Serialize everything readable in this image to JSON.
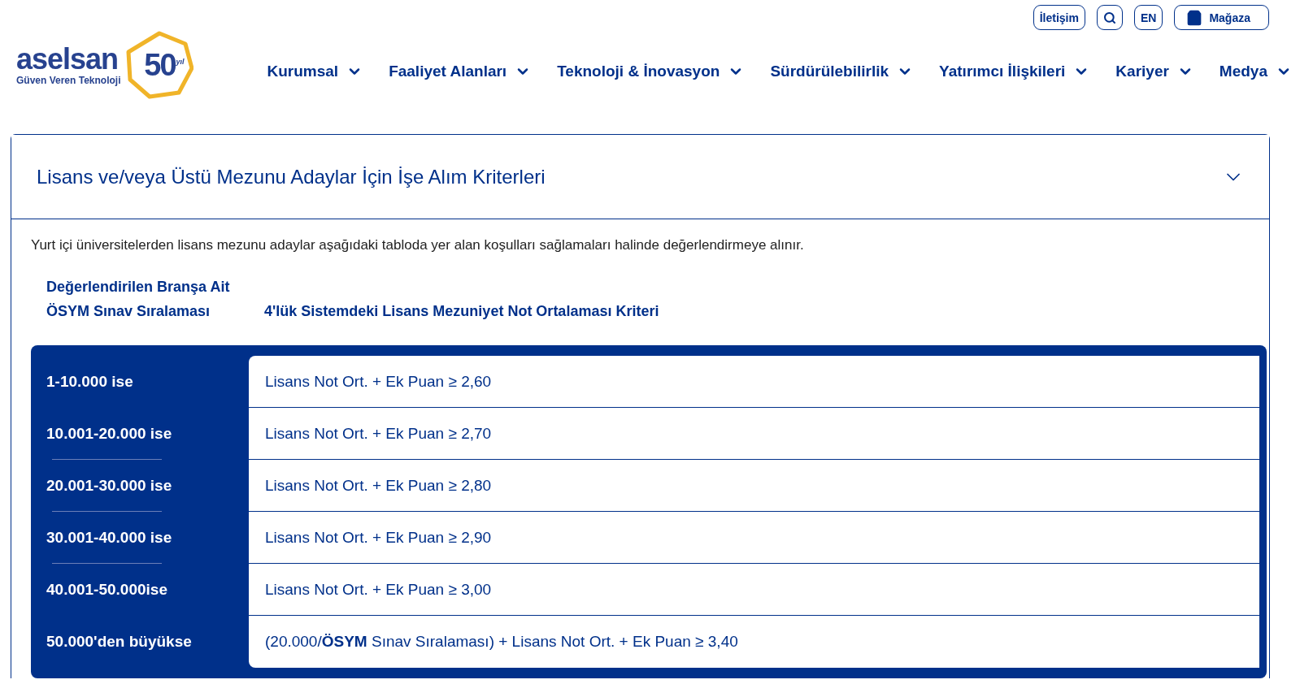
{
  "logo": {
    "wordmark": "aselsan",
    "tagline": "Güven Veren Teknoloji",
    "badge_number": "50",
    "badge_suffix": "yıl"
  },
  "top_links": [
    {
      "kind": "text",
      "label": "İletişim"
    },
    {
      "kind": "search"
    },
    {
      "kind": "text",
      "label": "EN"
    },
    {
      "kind": "shop",
      "label": "Mağaza"
    }
  ],
  "nav": [
    "Kurumsal",
    "Faaliyet Alanları",
    "Teknoloji & İnovasyon",
    "Sürdürülebilirlik",
    "Yatırımcı İlişkileri",
    "Kariyer",
    "Medya"
  ],
  "accordion": {
    "title": "Lisans ve/veya Üstü Mezunu Adaylar İçin İşe Alım Kriterleri",
    "expanded": true,
    "intro": "Yurt içi üniversitelerden lisans mezunu adaylar aşağıdaki tabloda yer alan koşulları sağlamaları halinde değerlendirmeye alınır.",
    "columns": [
      "Değerlendirilen Branşa Ait ÖSYM Sınav Sıralaması",
      "4'lük Sistemdeki Lisans Mezuniyet Not Ortalaması Kriteri"
    ],
    "rows": [
      {
        "rank": "1-10.000 ise",
        "criterion": "Lisans Not Ort. + Ek Puan ≥ 2,60"
      },
      {
        "rank": "10.001-20.000 ise",
        "criterion": "Lisans Not Ort. + Ek Puan ≥ 2,70"
      },
      {
        "rank": "20.001-30.000 ise",
        "criterion": "Lisans Not Ort. + Ek Puan ≥ 2,80"
      },
      {
        "rank": "30.001-40.000 ise",
        "criterion": "Lisans Not Ort. + Ek Puan ≥ 2,90"
      },
      {
        "rank": "40.001-50.000ise",
        "criterion": "Lisans Not Ort. + Ek Puan ≥ 3,00"
      },
      {
        "rank": "50.000'den büyükse",
        "criterion": "(20.000/**ÖSYM** Sınav Sıralaması) + Lisans Not Ort. + Ek Puan ≥ 3,40"
      }
    ]
  }
}
